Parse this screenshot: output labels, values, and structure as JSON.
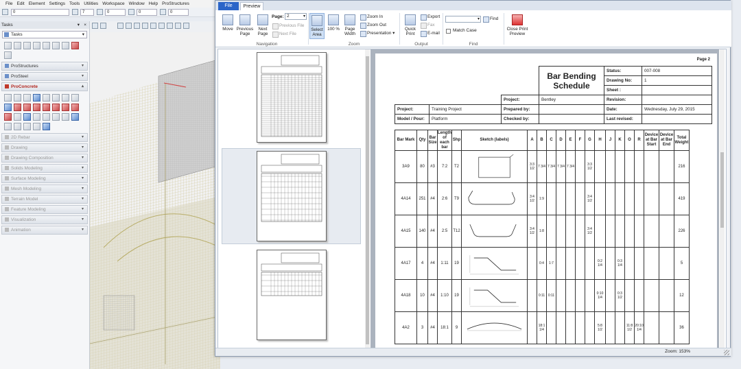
{
  "host": {
    "menu": [
      "File",
      "Edit",
      "Element",
      "Settings",
      "Tools",
      "Utilities",
      "Workspace",
      "Window",
      "Help",
      "ProStructures"
    ],
    "toolbar": {
      "level_value": "0",
      "val7": "7",
      "val0a": "0",
      "val0b": "0",
      "val0c": "0"
    },
    "tasks": {
      "title": "Tasks",
      "combo_value": "Tasks",
      "sections": [
        {
          "label": "ProStructures",
          "state": "normal"
        },
        {
          "label": "ProSteel",
          "state": "normal"
        },
        {
          "label": "ProConcrete",
          "state": "active"
        },
        {
          "label": "2D Rebar",
          "state": "muted"
        },
        {
          "label": "Drawing",
          "state": "muted"
        },
        {
          "label": "Drawing Composition",
          "state": "muted"
        },
        {
          "label": "Solids Modeling",
          "state": "muted"
        },
        {
          "label": "Surface Modeling",
          "state": "muted"
        },
        {
          "label": "Mesh Modeling",
          "state": "muted"
        },
        {
          "label": "Terrain Model",
          "state": "muted"
        },
        {
          "label": "Feature Modeling",
          "state": "muted"
        },
        {
          "label": "Visualization",
          "state": "muted"
        },
        {
          "label": "Animation",
          "state": "muted"
        }
      ]
    }
  },
  "preview": {
    "tabs": {
      "file": "File",
      "preview": "Preview"
    },
    "ribbon": {
      "navigation": {
        "label": "Navigation",
        "move": "Move",
        "previous_page": "Previous Page",
        "next_page": "Next Page",
        "page_label": "Page:",
        "page_value": "2",
        "previous_file": "Previous File",
        "next_file": "Next File"
      },
      "zoom": {
        "label": "Zoom",
        "select_area": "Select Area",
        "hundred": "100 %",
        "page_width": "Page Width",
        "zoom_in": "Zoom In",
        "zoom_out": "Zoom Out",
        "presentation": "Presentation"
      },
      "output": {
        "label": "Output",
        "quick_print": "Quick Print",
        "export": "Export",
        "fax": "Fax",
        "email": "E-mail"
      },
      "find": {
        "label": "Find",
        "find": "Find",
        "match_case": "Match Case",
        "close_print_preview": "Close Print Preview"
      }
    },
    "status": {
      "zoom": "Zoom: 153%"
    },
    "document": {
      "page_no": "Page 2",
      "title_line1": "Bar Bending",
      "title_line2": "Schedule",
      "status_label": "Status:",
      "status_value": "007-008",
      "drawing_no_label": "Drawing No:",
      "drawing_no_value": "1",
      "sheet_label": "Sheet :",
      "sheet_value": "",
      "project_label": "Project:",
      "project_value": "Bentley",
      "revision_label": "Revision:",
      "revision_value": "",
      "project2_label": "Project:",
      "project2_value": "Training Project",
      "prepared_label": "Prepared by:",
      "prepared_value": "",
      "date_label": "Date:",
      "date_value": "Wednesday, July 29, 2015",
      "model_label": "Model / Pour:",
      "model_value": "Platform",
      "checked_label": "Checked by:",
      "checked_value": "",
      "last_revised_label": "Last revised:",
      "last_revised_value": "",
      "columns": [
        "Bar Mark",
        "Qty",
        "Bar Size",
        "Length of each bar",
        "Shp",
        "Sketch (labels)",
        "A",
        "B",
        "C",
        "D",
        "E",
        "F",
        "G",
        "H",
        "J",
        "K",
        "O",
        "R",
        "Device at Bar Start",
        "Device at Bar End",
        "Total Weight"
      ],
      "rows": [
        {
          "mark": "3A9",
          "qty": "80",
          "size": "#3",
          "length": "7:2",
          "shp": "T2",
          "sketch": "rect",
          "A": "3:3 1/2",
          "B": "7 3/4",
          "C": "7 3/4",
          "D": "7 3/4",
          "E": "7 3/4",
          "F": "",
          "G": "3:3 1/2",
          "H": "",
          "J": "",
          "K": "",
          "O": "",
          "R": "",
          "dev_start": "",
          "dev_end": "",
          "weight": "216"
        },
        {
          "mark": "4A14",
          "qty": "251",
          "size": "#4",
          "length": "2:6",
          "shp": "T9",
          "sketch": "hookL",
          "A": "3:4 1/2",
          "B": "1:9",
          "C": "",
          "D": "",
          "E": "",
          "F": "",
          "G": "3:4 1/2",
          "H": "",
          "J": "",
          "K": "",
          "O": "",
          "R": "",
          "dev_start": "",
          "dev_end": "",
          "weight": "419"
        },
        {
          "mark": "4A15",
          "qty": "140",
          "size": "#4",
          "length": "2:5",
          "shp": "T12",
          "sketch": "hookT",
          "A": "3:4 1/2",
          "B": "1:8",
          "C": "",
          "D": "",
          "E": "",
          "F": "",
          "G": "3:4 1/2",
          "H": "",
          "J": "",
          "K": "",
          "O": "",
          "R": "",
          "dev_start": "",
          "dev_end": "",
          "weight": "226"
        },
        {
          "mark": "4A17",
          "qty": "4",
          "size": "#4",
          "length": "1:11",
          "shp": "19",
          "sketch": "crank",
          "A": "",
          "B": "0:4",
          "C": "1:7",
          "D": "",
          "E": "",
          "F": "",
          "G": "",
          "H": "0:2 1/4",
          "J": "",
          "K": "0:3 1/4",
          "O": "",
          "R": "",
          "dev_start": "",
          "dev_end": "",
          "weight": "5"
        },
        {
          "mark": "4A18",
          "qty": "10",
          "size": "#4",
          "length": "1:10",
          "shp": "19",
          "sketch": "crank",
          "A": "",
          "B": "0:11",
          "C": "0:11",
          "D": "",
          "E": "",
          "F": "",
          "G": "",
          "H": "0:10 1/4",
          "J": "",
          "K": "0:3 1/2",
          "O": "",
          "R": "",
          "dev_start": "",
          "dev_end": "",
          "weight": "12"
        },
        {
          "mark": "4A2",
          "qty": "3",
          "size": "#4",
          "length": "18:1",
          "shp": "9",
          "sketch": "arc",
          "A": "",
          "B": "18:1 1/4",
          "C": "",
          "D": "",
          "E": "",
          "F": "",
          "G": "",
          "H": "5:8 1/2",
          "J": "",
          "K": "",
          "O": "11:8 1/2",
          "R": "20:10 1/4",
          "dev_start": "",
          "dev_end": "",
          "weight": "36"
        }
      ]
    }
  }
}
